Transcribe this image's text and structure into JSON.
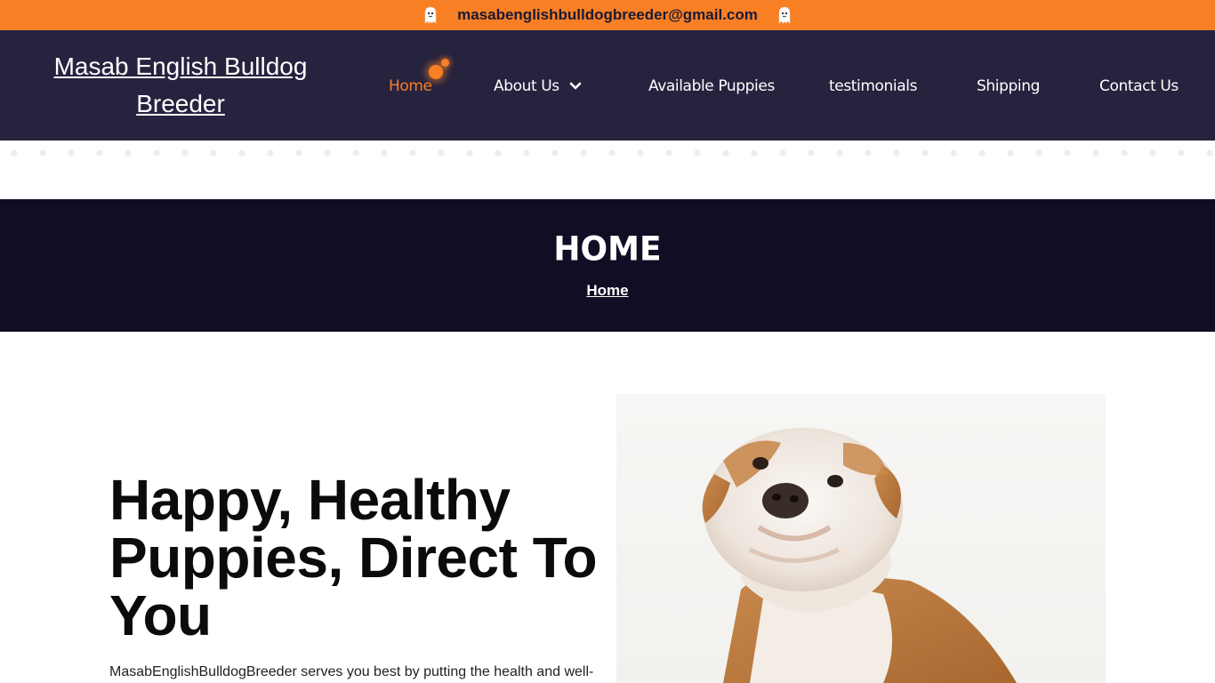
{
  "topbar": {
    "email": "masabenglishbulldogbreeder@gmail.com",
    "icons": [
      "ghost-icon",
      "ghost-icon"
    ],
    "background": "#f97f25"
  },
  "header": {
    "brand": "Masab English Bulldog Breeder",
    "background": "#26233f",
    "nav": [
      {
        "label": "Home",
        "active": true
      },
      {
        "label": "About Us",
        "has_dropdown": true
      },
      {
        "label": "Available Puppies"
      },
      {
        "label": "testimonials"
      },
      {
        "label": "Shipping"
      },
      {
        "label": "Contact Us"
      }
    ],
    "accent": "#f97f25"
  },
  "page_header": {
    "title": "HOME",
    "breadcrumb": "Home",
    "background": "#100e24"
  },
  "hero": {
    "headline": "Happy, Healthy Puppies, Direct To You",
    "lead": "MasabEnglishBulldogBreeder serves you best by putting the health and well-",
    "image": "bulldog-puppy-photo"
  }
}
